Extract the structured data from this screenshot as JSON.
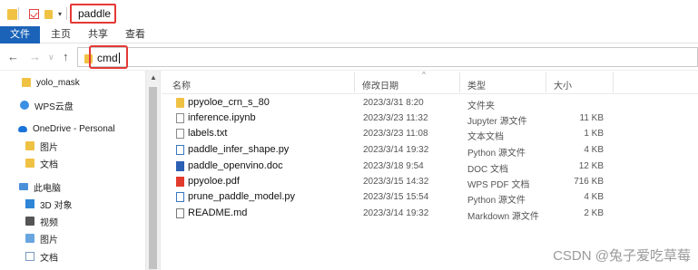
{
  "titlebar": {
    "title": "paddle"
  },
  "ribbon": {
    "tabs": [
      "文件",
      "主页",
      "共享",
      "查看"
    ]
  },
  "address": {
    "value": "cmd"
  },
  "sidebar": {
    "items": [
      {
        "label": "yolo_mask",
        "icon": "folder-icon"
      },
      {
        "label": "WPS云盘",
        "icon": "wps-cloud-icon"
      },
      {
        "label": "OneDrive - Personal",
        "icon": "onedrive-icon"
      },
      {
        "label": "图片",
        "icon": "folder-icon"
      },
      {
        "label": "文档",
        "icon": "folder-icon"
      },
      {
        "label": "此电脑",
        "icon": "pc-icon"
      },
      {
        "label": "3D 对象",
        "icon": "3d-objects-icon"
      },
      {
        "label": "视频",
        "icon": "video-icon"
      },
      {
        "label": "图片",
        "icon": "pictures-icon"
      },
      {
        "label": "文档",
        "icon": "documents-icon"
      }
    ]
  },
  "columns": {
    "name": "名称",
    "date": "修改日期",
    "type": "类型",
    "size": "大小"
  },
  "files": [
    {
      "name": "ppyoloe_crn_s_80",
      "date": "2023/3/31 8:20",
      "type": "文件夹",
      "size": "",
      "icon": "folder-icon"
    },
    {
      "name": "inference.ipynb",
      "date": "2023/3/23 11:32",
      "type": "Jupyter 源文件",
      "size": "11 KB",
      "icon": "notebook-file-icon"
    },
    {
      "name": "labels.txt",
      "date": "2023/3/23 11:08",
      "type": "文本文档",
      "size": "1 KB",
      "icon": "text-file-icon"
    },
    {
      "name": "paddle_infer_shape.py",
      "date": "2023/3/14 19:32",
      "type": "Python 源文件",
      "size": "4 KB",
      "icon": "python-file-icon"
    },
    {
      "name": "paddle_openvino.doc",
      "date": "2023/3/18 9:54",
      "type": "DOC 文档",
      "size": "12 KB",
      "icon": "word-file-icon"
    },
    {
      "name": "ppyoloe.pdf",
      "date": "2023/3/15 14:32",
      "type": "WPS PDF 文档",
      "size": "716 KB",
      "icon": "pdf-file-icon"
    },
    {
      "name": "prune_paddle_model.py",
      "date": "2023/3/15 15:54",
      "type": "Python 源文件",
      "size": "4 KB",
      "icon": "python-file-icon"
    },
    {
      "name": "README.md",
      "date": "2023/3/14 19:32",
      "type": "Markdown 源文件",
      "size": "2 KB",
      "icon": "markdown-file-icon"
    }
  ],
  "watermark": "CSDN @兔子爱吃草莓"
}
